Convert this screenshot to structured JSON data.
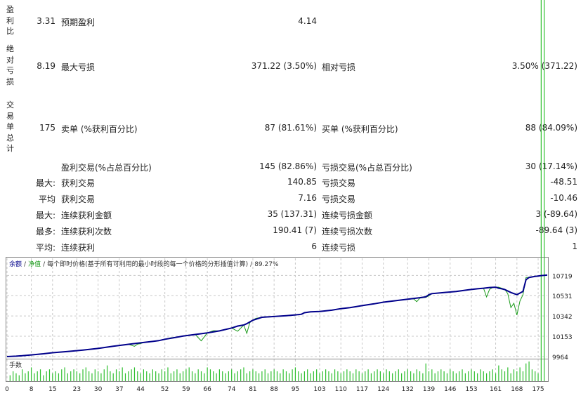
{
  "report": {
    "sections": [
      {
        "side_label": "盈\n利\n比",
        "value": "3.31",
        "label": "预期盈利",
        "mid_value": "4.14",
        "right_label": "",
        "right_value": ""
      },
      {
        "side_label": "绝\n对\n亏\n损",
        "value": "8.19",
        "label": "最大亏损",
        "mid_value": "371.22 (3.50%)",
        "right_label": "相对亏损",
        "right_value": "3.50% (371.22)"
      },
      {
        "side_label": "交\n易\n单\n总\n计",
        "value": "175",
        "label": "卖单 (%获利百分比)",
        "mid_value": "87 (81.61%)",
        "right_label": "买单 (%获利百分比)",
        "right_value": "88 (84.09%)"
      }
    ],
    "rows": [
      {
        "prefix": "",
        "label": "盈利交易(%占总百分比)",
        "mid_value": "145 (82.86%)",
        "right_label": "亏损交易(%占总百分比)",
        "right_value": "30 (17.14%)"
      },
      {
        "prefix": "最大:",
        "label": "获利交易",
        "mid_value": "140.85",
        "right_label": "亏损交易",
        "right_value": "-48.51"
      },
      {
        "prefix": "平均",
        "label": "获利交易",
        "mid_value": "7.16",
        "right_label": "亏损交易",
        "right_value": "-10.46"
      },
      {
        "prefix": "最大:",
        "label": "连续获利金额",
        "mid_value": "35 (137.31)",
        "right_label": "连续亏损金额",
        "right_value": "3 (-89.64)"
      },
      {
        "prefix": "最多:",
        "label": "连续获利次数",
        "mid_value": "190.41 (7)",
        "right_label": "连续亏损次数",
        "right_value": "-89.64 (3)"
      },
      {
        "prefix": "平均:",
        "label": "连续获利",
        "mid_value": "6",
        "right_label": "连续亏损",
        "right_value": "1"
      }
    ]
  },
  "chart_data": {
    "type": "line",
    "legend": {
      "balance": "余额",
      "equity": "净值",
      "description": "每个即时价格(基于所有可利用的最小时段的每一个价格的分形插值计算)",
      "quality": "89.27%"
    },
    "legend_separators": [
      "/",
      "/",
      "/"
    ],
    "colors": {
      "balance": "#00008b",
      "equity": "#1a9a1a",
      "volume": "#2fbf2f",
      "grid": "#c8c8c8"
    },
    "ylim": [
      9964,
      10800
    ],
    "yticks": [
      10719,
      10531,
      10342,
      10153,
      9964
    ],
    "xlim": [
      0,
      178
    ],
    "xticks": [
      0,
      8,
      15,
      23,
      30,
      37,
      44,
      52,
      59,
      66,
      74,
      81,
      88,
      95,
      103,
      110,
      117,
      124,
      132,
      139,
      146,
      153,
      161,
      168,
      175
    ],
    "series": [
      {
        "name": "余额",
        "x": [
          0,
          3,
          5,
          8,
          12,
          15,
          20,
          25,
          30,
          35,
          40,
          45,
          48,
          50,
          52,
          55,
          58,
          62,
          66,
          70,
          74,
          76,
          78,
          79,
          81,
          84,
          88,
          92,
          95,
          97,
          98,
          100,
          103,
          107,
          110,
          113,
          117,
          121,
          124,
          128,
          132,
          136,
          138,
          139,
          140,
          144,
          148,
          152,
          155,
          157,
          159,
          161,
          162,
          163,
          164,
          166,
          168,
          170,
          171,
          172,
          173,
          174,
          175,
          176,
          177,
          178
        ],
        "values": [
          9964,
          9968,
          9972,
          9980,
          9990,
          10000,
          10012,
          10025,
          10040,
          10060,
          10078,
          10095,
          10105,
          10112,
          10125,
          10140,
          10155,
          10170,
          10185,
          10203,
          10230,
          10248,
          10258,
          10270,
          10302,
          10330,
          10337,
          10345,
          10352,
          10358,
          10372,
          10380,
          10384,
          10396,
          10410,
          10420,
          10438,
          10455,
          10470,
          10484,
          10498,
          10512,
          10520,
          10540,
          10550,
          10560,
          10570,
          10585,
          10595,
          10600,
          10607,
          10610,
          10600,
          10595,
          10588,
          10560,
          10540,
          10570,
          10680,
          10700,
          10705,
          10710,
          10714,
          10718,
          10720,
          10722
        ]
      },
      {
        "name": "净值",
        "x": [
          0,
          3,
          5,
          8,
          12,
          15,
          20,
          25,
          30,
          35,
          40,
          42,
          43,
          44,
          45,
          48,
          50,
          52,
          54,
          56,
          58,
          60,
          62,
          64,
          66,
          68,
          70,
          72,
          74,
          76,
          78,
          79,
          80,
          81,
          82,
          84,
          88,
          92,
          95,
          97,
          98,
          100,
          103,
          107,
          110,
          113,
          117,
          121,
          124,
          128,
          132,
          134,
          135,
          136,
          137,
          138,
          139,
          140,
          144,
          148,
          152,
          155,
          157,
          158,
          159,
          160,
          161,
          162,
          163,
          164,
          165,
          166,
          167,
          168,
          169,
          170,
          171,
          172,
          173,
          174,
          175,
          176,
          177,
          178
        ],
        "values": [
          9964,
          9968,
          9972,
          9980,
          9990,
          10000,
          10012,
          10025,
          10040,
          10060,
          10078,
          10060,
          10080,
          10085,
          10095,
          10105,
          10112,
          10125,
          10140,
          10145,
          10155,
          10165,
          10170,
          10110,
          10185,
          10205,
          10203,
          10215,
          10230,
          10200,
          10258,
          10180,
          10280,
          10302,
          10320,
          10330,
          10337,
          10345,
          10352,
          10358,
          10372,
          10380,
          10384,
          10396,
          10410,
          10420,
          10438,
          10455,
          10470,
          10484,
          10498,
          10500,
          10475,
          10508,
          10512,
          10515,
          10530,
          10550,
          10560,
          10570,
          10585,
          10595,
          10600,
          10520,
          10590,
          10607,
          10610,
          10610,
          10600,
          10590,
          10550,
          10420,
          10460,
          10350,
          10480,
          10540,
          10700,
          10700,
          10705,
          10710,
          10714,
          10718,
          10720,
          10722
        ]
      }
    ],
    "volume": {
      "label": "手数",
      "x": [
        1,
        2,
        3,
        4,
        5,
        6,
        7,
        8,
        9,
        10,
        11,
        12,
        13,
        14,
        15,
        16,
        17,
        18,
        19,
        20,
        21,
        22,
        23,
        24,
        25,
        26,
        27,
        28,
        29,
        30,
        31,
        32,
        33,
        34,
        35,
        36,
        37,
        38,
        39,
        40,
        41,
        42,
        43,
        44,
        45,
        46,
        47,
        48,
        49,
        50,
        51,
        52,
        53,
        54,
        55,
        56,
        57,
        58,
        59,
        60,
        61,
        62,
        63,
        64,
        65,
        66,
        67,
        68,
        69,
        70,
        71,
        72,
        73,
        74,
        75,
        76,
        77,
        78,
        79,
        80,
        81,
        82,
        83,
        84,
        85,
        86,
        87,
        88,
        89,
        90,
        91,
        92,
        93,
        94,
        95,
        96,
        97,
        98,
        99,
        100,
        101,
        102,
        103,
        104,
        105,
        106,
        107,
        108,
        109,
        110,
        111,
        112,
        113,
        114,
        115,
        116,
        117,
        118,
        119,
        120,
        121,
        122,
        123,
        124,
        125,
        126,
        127,
        128,
        129,
        130,
        131,
        132,
        133,
        134,
        135,
        136,
        137,
        138,
        139,
        140,
        141,
        142,
        143,
        144,
        145,
        146,
        147,
        148,
        149,
        150,
        151,
        152,
        153,
        154,
        155,
        156,
        157,
        158,
        159,
        160,
        161,
        162,
        163,
        164,
        165,
        166,
        167,
        168,
        169,
        170,
        171,
        172,
        173,
        174,
        175,
        176,
        177
      ],
      "values": [
        0.3,
        0.5,
        0.4,
        0.3,
        0.6,
        0.4,
        0.5,
        0.7,
        0.4,
        0.5,
        0.6,
        0.3,
        0.5,
        0.6,
        0.4,
        0.5,
        0.4,
        0.6,
        0.7,
        0.4,
        0.5,
        0.6,
        0.5,
        0.4,
        0.6,
        0.7,
        0.5,
        0.4,
        0.6,
        0.5,
        0.4,
        0.6,
        0.8,
        0.5,
        0.4,
        0.6,
        0.5,
        0.7,
        0.4,
        0.5,
        0.6,
        0.7,
        0.5,
        0.4,
        0.6,
        0.5,
        0.4,
        0.6,
        0.5,
        0.4,
        0.6,
        0.5,
        0.7,
        0.4,
        0.5,
        0.6,
        0.4,
        0.5,
        0.6,
        0.7,
        0.5,
        0.4,
        0.6,
        0.5,
        0.4,
        0.7,
        0.6,
        0.5,
        0.4,
        0.6,
        0.5,
        0.4,
        0.5,
        0.6,
        0.4,
        0.5,
        0.6,
        0.7,
        0.4,
        0.5,
        0.6,
        0.5,
        0.4,
        0.5,
        0.6,
        0.4,
        0.5,
        0.6,
        0.5,
        0.4,
        0.6,
        0.5,
        0.4,
        0.6,
        0.7,
        0.5,
        0.4,
        0.5,
        0.6,
        0.4,
        0.5,
        0.6,
        0.4,
        0.5,
        0.6,
        0.5,
        0.4,
        0.6,
        0.5,
        0.4,
        0.5,
        0.6,
        0.5,
        0.4,
        0.6,
        0.5,
        0.4,
        0.5,
        0.6,
        0.4,
        0.5,
        0.6,
        0.5,
        0.4,
        0.6,
        0.5,
        0.4,
        0.5,
        0.6,
        0.4,
        0.5,
        0.6,
        0.5,
        0.4,
        0.6,
        0.5,
        0.4,
        0.9,
        0.5,
        0.6,
        0.4,
        0.5,
        0.6,
        0.5,
        0.4,
        0.6,
        0.5,
        0.4,
        0.5,
        0.6,
        0.4,
        0.5,
        0.6,
        0.5,
        0.4,
        0.6,
        0.5,
        0.4,
        0.5,
        0.6,
        0.4,
        0.8,
        0.6,
        0.5,
        0.7,
        0.4,
        0.6,
        0.5,
        0.7,
        0.5,
        0.9,
        1.0,
        0.6,
        0.5,
        0.4
      ]
    }
  }
}
